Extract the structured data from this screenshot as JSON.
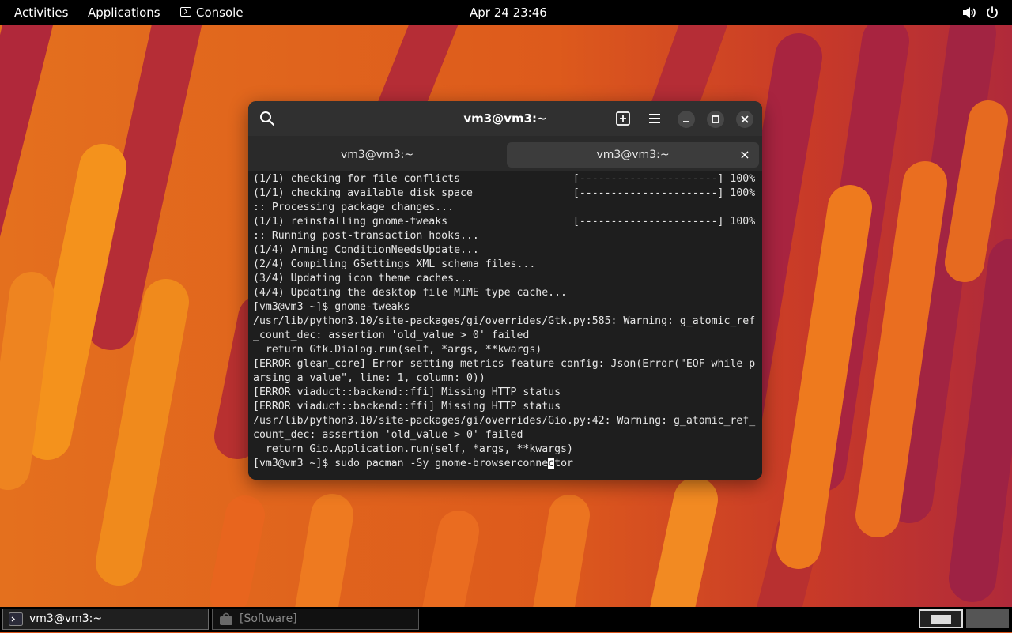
{
  "topbar": {
    "activities": "Activities",
    "applications": "Applications",
    "console": "Console",
    "datetime": "Apr 24  23:46"
  },
  "window": {
    "title": "vm3@vm3:~",
    "tabs": [
      {
        "label": "vm3@vm3:~",
        "active": false
      },
      {
        "label": "vm3@vm3:~",
        "active": true
      }
    ],
    "close_tab": "×"
  },
  "terminal": {
    "lines": [
      "(1/1) checking for file conflicts                  [----------------------] 100%",
      "(1/1) checking available disk space                [----------------------] 100%",
      ":: Processing package changes...",
      "(1/1) reinstalling gnome-tweaks                    [----------------------] 100%",
      ":: Running post-transaction hooks...",
      "(1/4) Arming ConditionNeedsUpdate...",
      "(2/4) Compiling GSettings XML schema files...",
      "(3/4) Updating icon theme caches...",
      "(4/4) Updating the desktop file MIME type cache...",
      "[vm3@vm3 ~]$ gnome-tweaks",
      "/usr/lib/python3.10/site-packages/gi/overrides/Gtk.py:585: Warning: g_atomic_ref",
      "_count_dec: assertion 'old_value > 0' failed",
      "  return Gtk.Dialog.run(self, *args, **kwargs)",
      "[ERROR glean_core] Error setting metrics feature config: Json(Error(\"EOF while p",
      "arsing a value\", line: 1, column: 0))",
      "[ERROR viaduct::backend::ffi] Missing HTTP status",
      "[ERROR viaduct::backend::ffi] Missing HTTP status",
      "/usr/lib/python3.10/site-packages/gi/overrides/Gio.py:42: Warning: g_atomic_ref_",
      "count_dec: assertion 'old_value > 0' failed",
      "  return Gio.Application.run(self, *args, **kwargs)"
    ],
    "prompt_before_cursor": "[vm3@vm3 ~]$ sudo pacman -Sy gnome-browserconne",
    "prompt_cursor_char": "c",
    "prompt_after_cursor": "tor"
  },
  "taskbar": {
    "tasks": [
      {
        "label": "vm3@vm3:~",
        "active": true
      },
      {
        "label": "[Software]",
        "active": false
      }
    ]
  },
  "colors": {
    "wallpaper_base": "#d9551c",
    "wallpaper_red": "#b0283a",
    "wallpaper_orange": "#f08a1c",
    "terminal_bg": "#1e1e1e",
    "headerbar_bg": "#303030"
  }
}
